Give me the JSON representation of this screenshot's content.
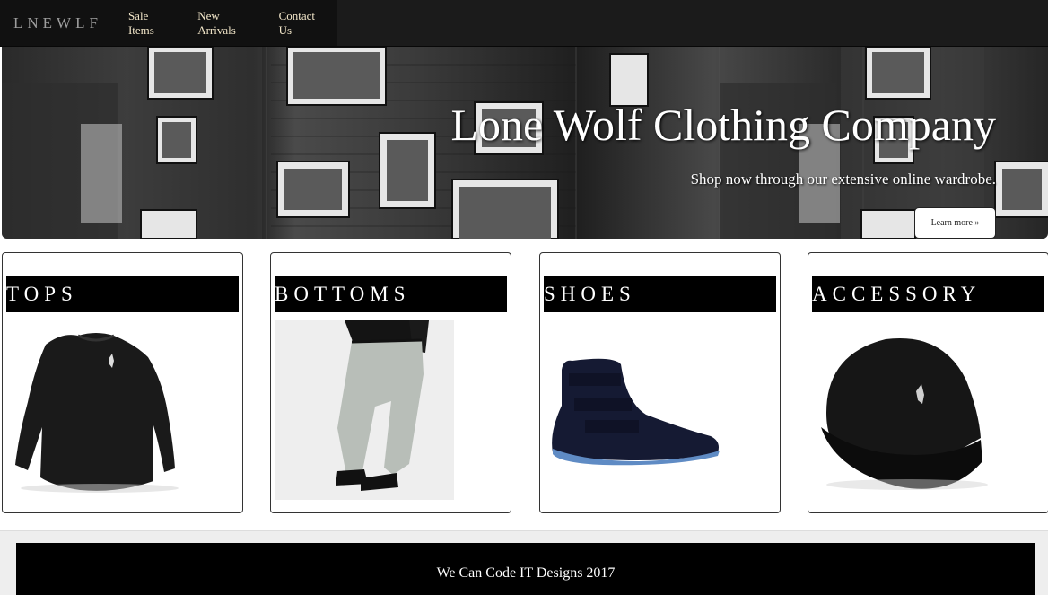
{
  "navbar": {
    "brand": "LNEWLF",
    "links": [
      "Sale Items",
      "New Arrivals",
      "Contact Us"
    ]
  },
  "hero": {
    "title": "Lone Wolf Clothing Company",
    "subtitle": "Shop now through our extensive online wardrobe.",
    "button_label": "Learn more »"
  },
  "categories": [
    {
      "label": "TOPS",
      "image": "black-sweater"
    },
    {
      "label": "BOTTOMS",
      "image": "grey-pants-model"
    },
    {
      "label": "SHOES",
      "image": "navy-hightop-sneaker"
    },
    {
      "label": "ACCESSORY",
      "image": "black-cap"
    }
  ],
  "footer": {
    "text": "We Can Code IT Designs 2017"
  },
  "colors": {
    "navbar_bg": "#1b1b1b",
    "nav_link": "#f2e6c9",
    "brand": "#9d9d9d",
    "card_title_bg": "#000000",
    "footer_bg": "#000000"
  }
}
